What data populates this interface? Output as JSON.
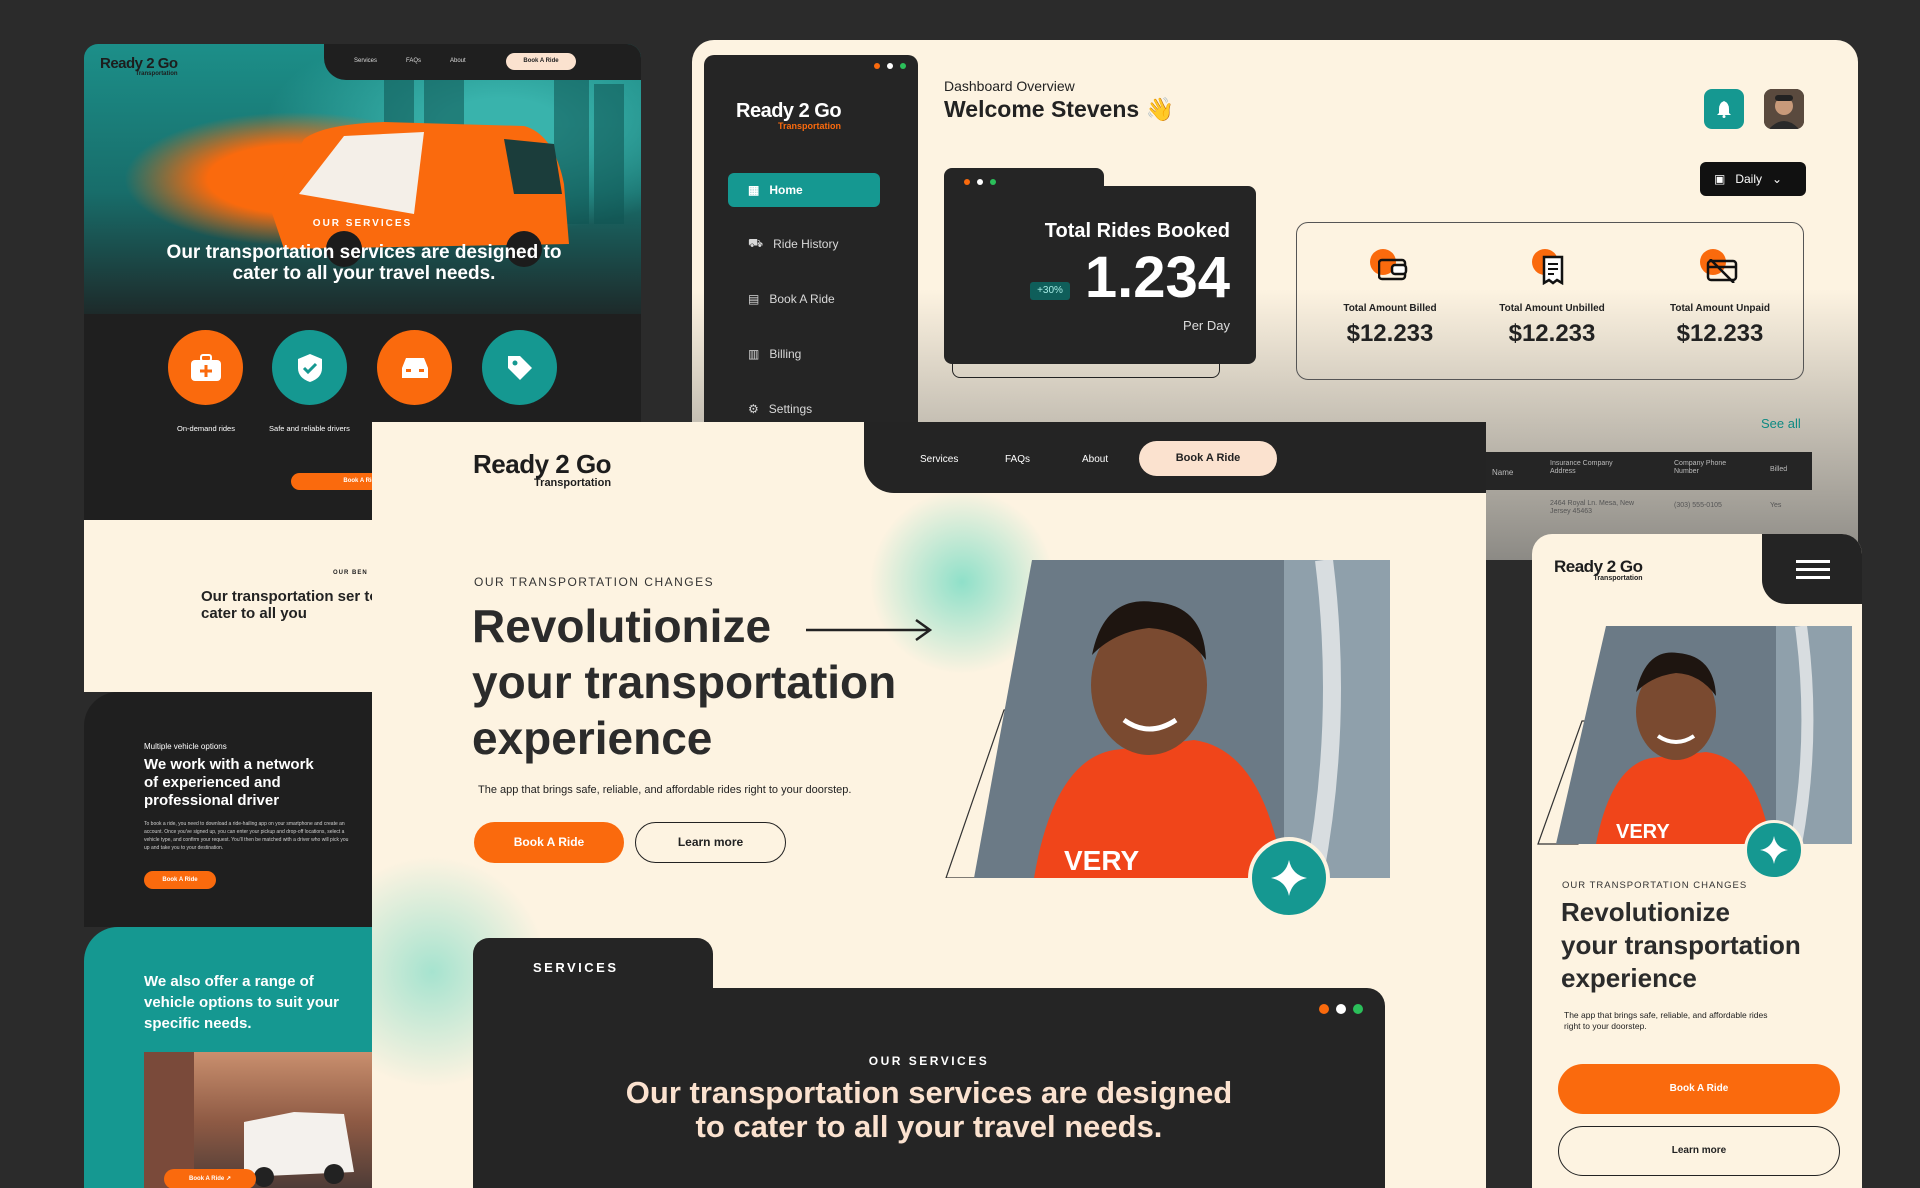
{
  "brand": {
    "name": "Ready 2 Go",
    "tagline": "Transportation"
  },
  "colors": {
    "orange": "#fa6a0d",
    "teal": "#159891",
    "dark": "#242424",
    "cream": "#fdf3e1"
  },
  "web_mock": {
    "nav": [
      "Services",
      "FAQs",
      "About"
    ],
    "nav_cta": "Book A Ride",
    "section_label": "OUR SERVICES",
    "headline": "Our transportation services are designed to cater to all your travel needs.",
    "features": [
      {
        "icon": "medical-kit-icon",
        "label": "On-demand rides"
      },
      {
        "icon": "shield-check-icon",
        "label": "Safe and reliable drivers"
      },
      {
        "icon": "car-icon",
        "label": ""
      },
      {
        "icon": "tag-icon",
        "label": ""
      }
    ],
    "cta": "Book A Ride",
    "benefits_label": "OUR BEN",
    "benefits_headline": "Our transportation ser to cater to all you",
    "vehicle_label": "Multiple vehicle options",
    "vehicle_title": "We work with a network of experienced and professional driver",
    "vehicle_body": "To book a ride, you need to download a ride-hailing app on your smartphone and create an account. Once you've signed up, you can enter your pickup and drop-off locations, select a vehicle type, and confirm your request. You'll then be matched with a driver who will pick you up and take you to your destination.",
    "vehicle_cta": "Book A Ride",
    "range_text": "We also offer a range of vehicle options to suit your specific needs.",
    "range_cta": "Book A Ride"
  },
  "dashboard": {
    "nav": [
      {
        "icon": "grid-icon",
        "label": "Home"
      },
      {
        "icon": "car-icon",
        "label": "Ride History"
      },
      {
        "icon": "book-icon",
        "label": "Book A Ride"
      },
      {
        "icon": "receipt-icon",
        "label": "Billing"
      },
      {
        "icon": "gear-icon",
        "label": "Settings"
      }
    ],
    "overline": "Dashboard Overview",
    "welcome": "Welcome Stevens",
    "period": "Daily",
    "total_title": "Total Rides Booked",
    "total_value": "1.234",
    "total_change": "+30%",
    "total_unit": "Per Day",
    "billing": [
      {
        "label": "Total Amount Billed",
        "value": "$12.233",
        "icon": "wallet-icon"
      },
      {
        "label": "Total Amount Unbilled",
        "value": "$12.233",
        "icon": "receipt-icon"
      },
      {
        "label": "Total Amount Unpaid",
        "value": "$12.233",
        "icon": "card-off-icon"
      }
    ],
    "see_all": "See all",
    "table_headers": [
      "Name",
      "Insurance Company Address",
      "Company Phone Number",
      "Billed"
    ],
    "table_row": [
      "",
      "2464 Royal Ln. Mesa, New Jersey 45463",
      "(303) 555-0105",
      "Yes"
    ]
  },
  "landing": {
    "nav": [
      "Services",
      "FAQs",
      "About"
    ],
    "nav_cta": "Book A Ride",
    "overline": "OUR TRANSPORTATION CHANGES",
    "headline_1": "Revolutionize",
    "headline_2": "your transportation",
    "headline_3": "experience",
    "sub": "The app that brings safe, reliable, and affordable rides right to your doorstep.",
    "cta_primary": "Book A Ride",
    "cta_secondary": "Learn more",
    "services_tab": "SERVICES",
    "services_label": "OUR SERVICES",
    "services_headline_1": "Our transportation services are designed",
    "services_headline_2": "to cater to all your travel needs."
  },
  "mobile": {
    "overline": "OUR TRANSPORTATION CHANGES",
    "headline_1": "Revolutionize",
    "headline_2": "your transportation",
    "headline_3": "experience",
    "sub": "The app that brings safe, reliable, and affordable rides right to your doorstep.",
    "cta_primary": "Book A Ride",
    "cta_secondary": "Learn more"
  }
}
